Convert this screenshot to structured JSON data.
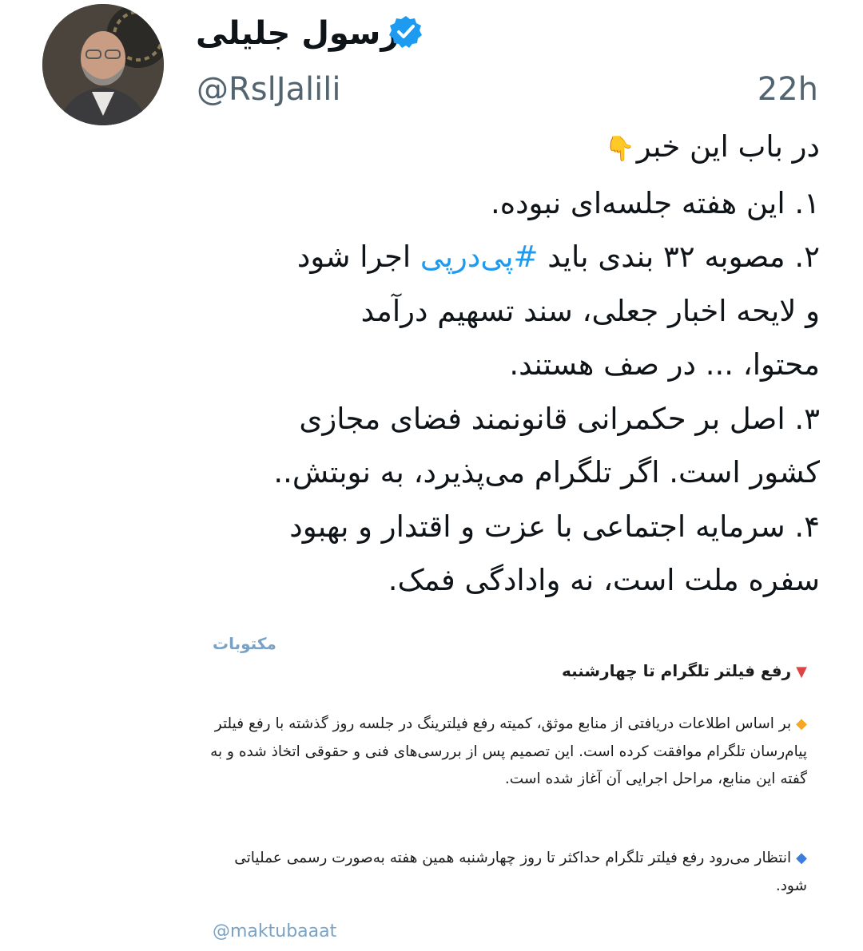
{
  "author": {
    "display_name": "رسول جلیلی",
    "handle": "@RslJalili",
    "verified": true
  },
  "timestamp": "22h",
  "tweet": {
    "line1_text": "در باب این خبر",
    "line1_emoji": "👇",
    "line2": "۱. این هفته جلسه‌ای نبوده.",
    "line3_before": "۲. مصوبه ۳۲ بندی باید ",
    "hashtag": "#پی‌درپی",
    "line3_after": " اجرا شود",
    "line4": "و لایحه اخبار جعلی، سند تسهیم درآمد",
    "line5": "محتوا، ... در صف هستند.",
    "line6": "۳. اصل بر حکمرانی قانونمند فضای مجازی",
    "line7": "کشور است. اگر تلگرام می‌پذیرد، به نوبتش..",
    "line8": "۴. سرمایه اجتماعی با عزت و اقتدار و بهبود",
    "line9": "سفره ملت است، نه وادادگی فمک."
  },
  "embed": {
    "source": "مکتوبات",
    "title": "رفع فیلتر تلگرام تا چهارشنبه",
    "paragraph1": "بر اساس اطلاعات دریافتی از منابع موثق، کمیته رفع فیلترینگ در جلسه روز گذشته با رفع فیلتر پیام‌رسان تلگرام موافقت کرده است. این تصمیم پس از بررسی‌های فنی و حقوقی اتخاذ شده و به گفته این منابع، مراحل اجرایی آن آغاز شده است.",
    "paragraph2": "انتظار می‌رود رفع فیلتر تلگرام حداکثر تا روز چهارشنبه همین هفته به‌صورت رسمی عملیاتی شود.",
    "handle": "@maktubaaat"
  },
  "colors": {
    "hashtag": "#1d9bf0",
    "secondary_text": "#536471",
    "verified_badge": "#1d9bf0"
  }
}
